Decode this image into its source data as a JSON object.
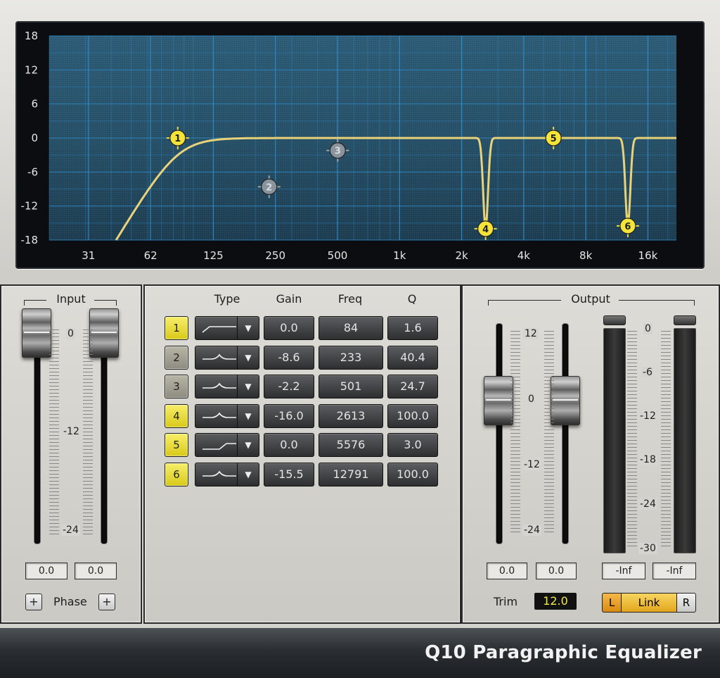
{
  "product_name": "Q10 Paragraphic Equalizer",
  "graph": {
    "y_labels": [
      "18",
      "12",
      "6",
      "0",
      "-6",
      "-12",
      "-18"
    ],
    "x_labels": [
      "31",
      "62",
      "125",
      "250",
      "500",
      "1k",
      "2k",
      "4k",
      "8k",
      "16k"
    ],
    "curve_color": "#e8d27a",
    "grid_color": "#2f8fd0",
    "handles": [
      {
        "num": "1",
        "freq": 84,
        "gain": 0.0,
        "active": true
      },
      {
        "num": "2",
        "freq": 233,
        "gain": -8.6,
        "active": false
      },
      {
        "num": "3",
        "freq": 501,
        "gain": -2.2,
        "active": false
      },
      {
        "num": "4",
        "freq": 2613,
        "gain": -16.0,
        "active": true
      },
      {
        "num": "5",
        "freq": 5576,
        "gain": 0.0,
        "active": true
      },
      {
        "num": "6",
        "freq": 12791,
        "gain": -15.5,
        "active": true
      }
    ]
  },
  "input": {
    "title": "Input",
    "scale": [
      "0",
      "-12",
      "-24"
    ],
    "values": [
      "0.0",
      "0.0"
    ],
    "phase_label": "Phase",
    "phase_button": "+"
  },
  "bands": {
    "headers": {
      "type": "Type",
      "gain": "Gain",
      "freq": "Freq",
      "q": "Q"
    },
    "rows": [
      {
        "num": "1",
        "active": true,
        "type": "low-cut-icon",
        "gain": "0.0",
        "freq": "84",
        "q": "1.6"
      },
      {
        "num": "2",
        "active": false,
        "type": "bell-icon",
        "gain": "-8.6",
        "freq": "233",
        "q": "40.4"
      },
      {
        "num": "3",
        "active": false,
        "type": "bell-icon",
        "gain": "-2.2",
        "freq": "501",
        "q": "24.7"
      },
      {
        "num": "4",
        "active": true,
        "type": "bell-icon",
        "gain": "-16.0",
        "freq": "2613",
        "q": "100.0"
      },
      {
        "num": "5",
        "active": true,
        "type": "high-shelf-icon",
        "gain": "0.0",
        "freq": "5576",
        "q": "3.0"
      },
      {
        "num": "6",
        "active": true,
        "type": "bell-icon",
        "gain": "-15.5",
        "freq": "12791",
        "q": "100.0"
      }
    ],
    "dropdown_arrow": "▼"
  },
  "output": {
    "title": "Output",
    "fader_scale": [
      "12",
      "0",
      "-12",
      "-24"
    ],
    "meter_scale": [
      "0",
      "-6",
      "-12",
      "-18",
      "-24",
      "-30"
    ],
    "fader_values": [
      "0.0",
      "0.0"
    ],
    "meter_values": [
      "-Inf",
      "-Inf"
    ],
    "trim_label": "Trim",
    "trim_value": "12.0",
    "link_left": "L",
    "link_label": "Link",
    "link_right": "R"
  }
}
